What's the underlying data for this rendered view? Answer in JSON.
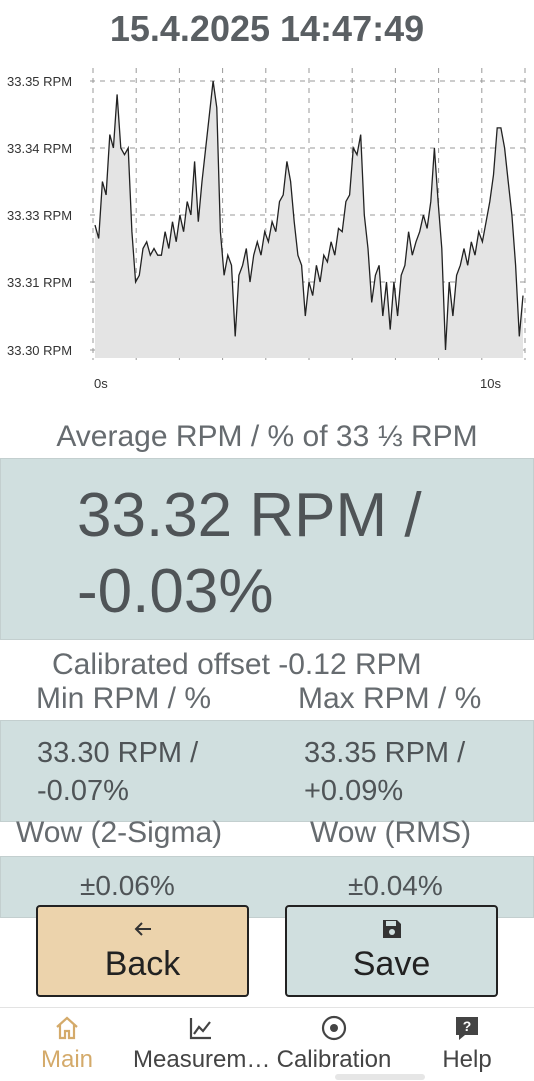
{
  "header": {
    "timestamp": "15.4.2025 14:47:49"
  },
  "chart_data": {
    "type": "area",
    "y_tick_labels": [
      "33.35 RPM",
      "33.34 RPM",
      "33.33 RPM",
      "33.31 RPM",
      "33.30 RPM"
    ],
    "y_ticks": [
      33.35,
      33.34,
      33.33,
      33.31,
      33.3
    ],
    "x_tick_labels": [
      "0s",
      "10s"
    ],
    "xlim": [
      0,
      10
    ],
    "grid": true,
    "fill_color": "#e4e4e4",
    "line_color": "#222222",
    "y": [
      33.327,
      33.323,
      33.335,
      33.333,
      33.342,
      33.34,
      33.348,
      33.34,
      33.339,
      33.34,
      33.325,
      33.31,
      33.312,
      33.32,
      33.322,
      33.318,
      33.32,
      33.318,
      33.318,
      33.325,
      33.32,
      33.328,
      33.322,
      33.33,
      33.325,
      33.332,
      33.33,
      33.338,
      33.328,
      33.335,
      33.34,
      33.345,
      33.35,
      33.346,
      33.325,
      33.312,
      33.318,
      33.315,
      33.302,
      33.312,
      33.315,
      33.32,
      33.31,
      33.318,
      33.322,
      33.318,
      33.325,
      33.322,
      33.328,
      33.325,
      33.332,
      33.333,
      33.338,
      33.335,
      33.328,
      33.318,
      33.315,
      33.305,
      33.31,
      33.308,
      33.315,
      33.31,
      33.318,
      33.316,
      33.322,
      33.318,
      33.326,
      33.325,
      33.332,
      33.333,
      33.34,
      33.339,
      33.342,
      33.33,
      33.32,
      33.307,
      33.312,
      33.315,
      33.305,
      33.31,
      33.303,
      33.31,
      33.305,
      33.312,
      33.315,
      33.325,
      33.318,
      33.322,
      33.325,
      33.33,
      33.326,
      33.332,
      33.34,
      33.332,
      33.32,
      33.3,
      33.31,
      33.305,
      33.312,
      33.315,
      33.32,
      33.315,
      33.322,
      33.318,
      33.325,
      33.322,
      33.328,
      33.332,
      33.336,
      33.343,
      33.343,
      33.34,
      33.335,
      33.33,
      33.315,
      33.302,
      33.308
    ],
    "average": {
      "label": "Average RPM / % of 33 ⅓ RPM",
      "value_line1": "33.32 RPM /",
      "value_line2": "-0.03%"
    },
    "calibrated_offset": "Calibrated offset  -0.12 RPM",
    "min": {
      "label": "Min RPM / %",
      "line1": "33.30 RPM /",
      "line2": "-0.07%"
    },
    "max": {
      "label": "Max RPM / %",
      "line1": "33.35 RPM /",
      "line2": "+0.09%"
    },
    "wow_sigma": {
      "label": "Wow (2-Sigma)",
      "value": "±0.06%"
    },
    "wow_rms": {
      "label": "Wow (RMS)",
      "value": "±0.04%"
    }
  },
  "buttons": {
    "back": {
      "label": "Back",
      "icon": "arrow-left-icon",
      "color": "#ecd3ac"
    },
    "save": {
      "label": "Save",
      "icon": "floppy-disk-icon",
      "color": "#d0dfdf"
    }
  },
  "nav": {
    "items": [
      {
        "label": "Main",
        "icon": "home-icon",
        "active": true
      },
      {
        "label": "Measurem…",
        "icon": "chart-line-icon",
        "active": false
      },
      {
        "label": "Calibration",
        "icon": "target-icon",
        "active": false
      },
      {
        "label": "Help",
        "icon": "help-icon",
        "active": false
      }
    ],
    "active_color": "#d4aa6a"
  }
}
